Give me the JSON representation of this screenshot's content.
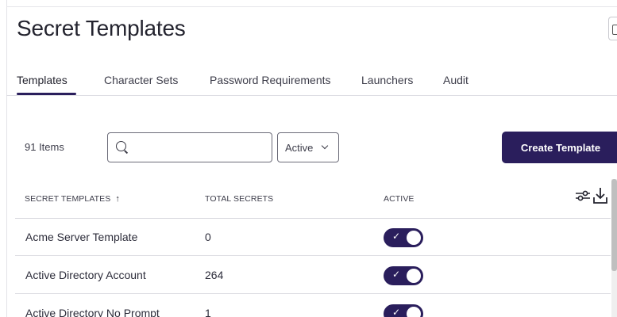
{
  "page": {
    "title": "Secret Templates"
  },
  "tabs": [
    {
      "label": "Templates",
      "active": true
    },
    {
      "label": "Character Sets",
      "active": false
    },
    {
      "label": "Password Requirements",
      "active": false
    },
    {
      "label": "Launchers",
      "active": false
    },
    {
      "label": "Audit",
      "active": false
    }
  ],
  "toolbar": {
    "item_count": "91 Items",
    "search_placeholder": "",
    "search_value": "",
    "filter_value": "Active",
    "create_label": "Create Template"
  },
  "table": {
    "columns": [
      "SECRET TEMPLATES",
      "TOTAL SECRETS",
      "ACTIVE"
    ],
    "sort_arrow": "↑",
    "rows": [
      {
        "name": "Acme Server Template",
        "total": "0",
        "active": true
      },
      {
        "name": "Active Directory Account",
        "total": "264",
        "active": true
      },
      {
        "name": "Active Directory No Prompt",
        "total": "1",
        "active": true
      }
    ]
  },
  "icons": {
    "search": "search-icon",
    "filter_chevron": "chevron-down-icon",
    "sort": "arrow-up-icon",
    "columns": "sliders-icon",
    "export": "download-icon",
    "toggle_check": "check-icon"
  },
  "colors": {
    "accent": "#2a1e5c",
    "text": "#2c2c3a",
    "border": "#dcdce2"
  },
  "toggle_check": "✓"
}
